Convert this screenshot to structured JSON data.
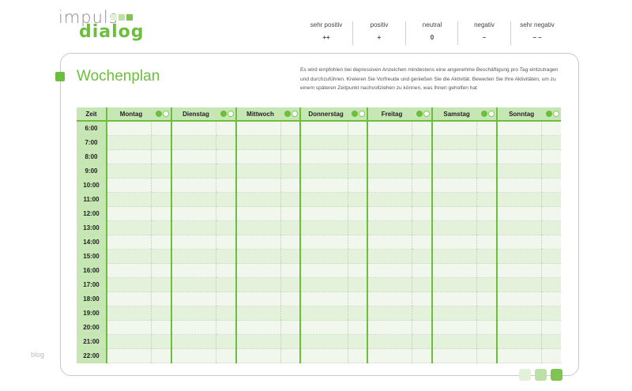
{
  "logo": {
    "line1": "impuls",
    "line2": "dialog"
  },
  "scale": [
    {
      "label": "sehr positiv",
      "symbol": "++"
    },
    {
      "label": "positiv",
      "symbol": "+"
    },
    {
      "label": "neutral",
      "symbol": "0"
    },
    {
      "label": "negativ",
      "symbol": "–"
    },
    {
      "label": "sehr negativ",
      "symbol": "– –"
    }
  ],
  "title": "Wochenplan",
  "description": "Es wird empfohlen bei depressiven Anzeichen mindestens eine angenehme Beschäftigung pro Tag eintzutragen und durchzuführen. Kreieren Sie Vorfreude und genießen Sie die Aktivität. Bewerten Sie Ihre Aktivitäten, um zu einem späteren Zeitpunkt nachvollziehen zu können, was Ihnen geholfen hat",
  "table": {
    "time_header": "Zeit",
    "days": [
      "Montag",
      "Dienstag",
      "Mittwoch",
      "Donnerstag",
      "Freitag",
      "Samstag",
      "Sonntag"
    ],
    "times": [
      "6:00",
      "7:00",
      "8:00",
      "9:00",
      "10:00",
      "11:00",
      "12:00",
      "13:00",
      "14:00",
      "15:00",
      "16:00",
      "17:00",
      "18:00",
      "19:00",
      "20:00",
      "21:00",
      "22:00"
    ]
  },
  "footer": {
    "blog": "blog"
  },
  "colors": {
    "accent": "#6bbf3c",
    "header_bg": "#c6e6b4",
    "row_light": "#f1f7ec",
    "row_dark": "#e4f1db"
  }
}
